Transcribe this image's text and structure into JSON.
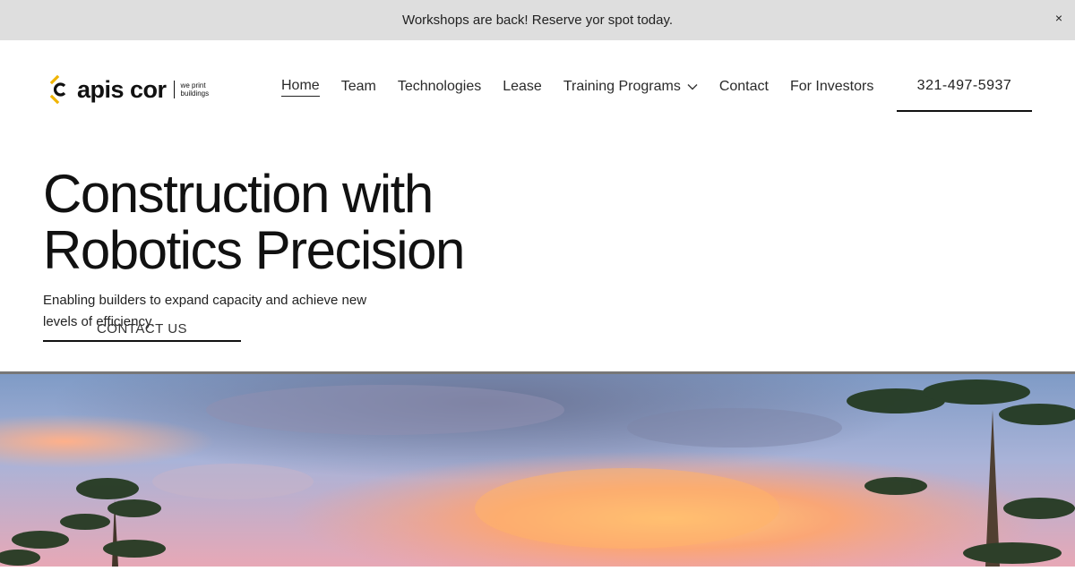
{
  "announcement": {
    "text": "Workshops are back! Reserve yor spot today.",
    "close_label": "×"
  },
  "logo": {
    "brand": "apis cor",
    "tagline": "we print buildings",
    "accent": "#f0b400"
  },
  "nav": {
    "items": [
      {
        "label": "Home",
        "active": true
      },
      {
        "label": "Team"
      },
      {
        "label": "Technologies"
      },
      {
        "label": "Lease"
      },
      {
        "label": "Training Programs",
        "dropdown": true
      },
      {
        "label": "Contact"
      },
      {
        "label": "For Investors"
      }
    ],
    "phone": "321-497-5937"
  },
  "hero": {
    "title_line1": "Construction with",
    "title_line2": "Robotics Precision",
    "subtitle": "Enabling builders to expand capacity and achieve new levels of efficiency.",
    "cta_label": "CONTACT US"
  },
  "hero_image": {
    "description_icon": "sunset-sky-pine-trees-image"
  }
}
